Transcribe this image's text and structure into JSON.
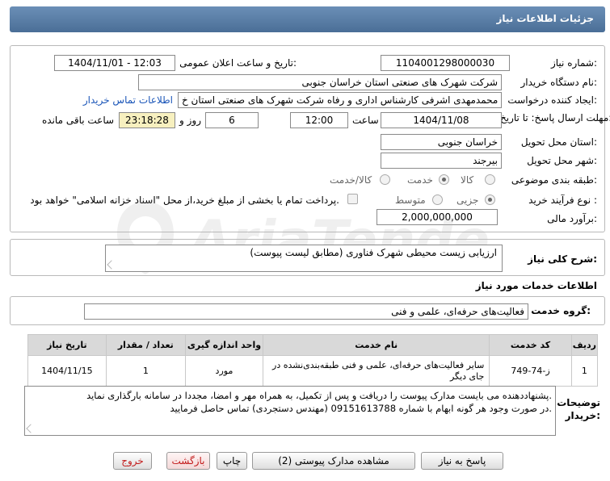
{
  "header": {
    "title": "جزئیات اطلاعات نیاز"
  },
  "need_number": {
    "label": "شماره نیاز:",
    "value": "1104001298000030"
  },
  "announce": {
    "label": "تاریخ و ساعت اعلان عمومی:",
    "value": "1404/11/01 - 12:03"
  },
  "buyer": {
    "label": "نام دستگاه خریدار:",
    "value": "شرکت شهرک های صنعتی استان خراسان جنوبی"
  },
  "creator": {
    "label": "ایجاد کننده درخواست:",
    "value": "محمدمهدی اشرفی کارشناس اداری و رفاه شرکت شهرک های صنعتی استان خ",
    "contact_link": "اطلاعات تماس خریدار"
  },
  "deadline": {
    "label": "مهلت ارسال پاسخ: تا تاریخ:",
    "date": "1404/11/08",
    "time_label": "ساعت",
    "time": "12:00",
    "days": "6",
    "days_label": "روز و",
    "remaining": "23:18:28",
    "remaining_label": "ساعت باقی مانده"
  },
  "province": {
    "label": "استان محل تحویل:",
    "value": "خراسان جنوبی"
  },
  "city": {
    "label": "شهر محل تحویل:",
    "value": "بیرجند"
  },
  "category": {
    "label": "طبقه بندی موضوعی:",
    "options": [
      "کالا",
      "خدمت",
      "کالا/خدمت"
    ],
    "selected": "خدمت"
  },
  "process": {
    "label": "نوع فرآیند خرید :",
    "options": [
      "جزیی",
      "متوسط"
    ],
    "selected": "جزیی",
    "treasury_note": "پرداخت تمام یا بخشی از مبلغ خرید،از محل \"اسناد خزانه اسلامی\" خواهد بود."
  },
  "budget": {
    "label": "برآورد مالی:",
    "value": "2,000,000,000"
  },
  "summary": {
    "label": "شرح کلی نیاز:",
    "value": "ارزیابی زیست محیطی شهرک فناوری (مطابق لیست پیوست)"
  },
  "services_heading": "اطلاعات خدمات مورد نیاز",
  "service_group": {
    "label": "گروه خدمت:",
    "value": "فعالیت‌های حرفه‌ای، علمی و فنی"
  },
  "table": {
    "columns": [
      "ردیف",
      "کد خدمت",
      "نام خدمت",
      "واحد اندازه گیری",
      "تعداد / مقدار",
      "تاریخ نیاز"
    ],
    "rows": [
      {
        "row": "1",
        "code": "ز-74-749",
        "name": "سایر فعالیت‌های حرفه‌ای، علمی و فنی طبقه‌بندی‌نشده در جای دیگر",
        "unit": "مورد",
        "qty": "1",
        "date": "1404/11/15"
      }
    ]
  },
  "buyer_notes": {
    "label": "توضیحات خریدار:",
    "line1": "پشنهاددهنده می بایست مدارک پیوست را دریافت و پس از تکمیل، به همراه مهر و امضا، مجددا در سامانه بارگذاری نماید.",
    "line2": "در صورت وجود هر گونه ابهام با شماره 09151613788 (مهندس دستجردی) تماس حاصل فرمایید."
  },
  "buttons": {
    "reply": "پاسخ به نیاز",
    "attachments": "مشاهده مدارک پیوستی (2)",
    "print": "چاپ",
    "back": "بازگشت",
    "exit": "خروج"
  }
}
